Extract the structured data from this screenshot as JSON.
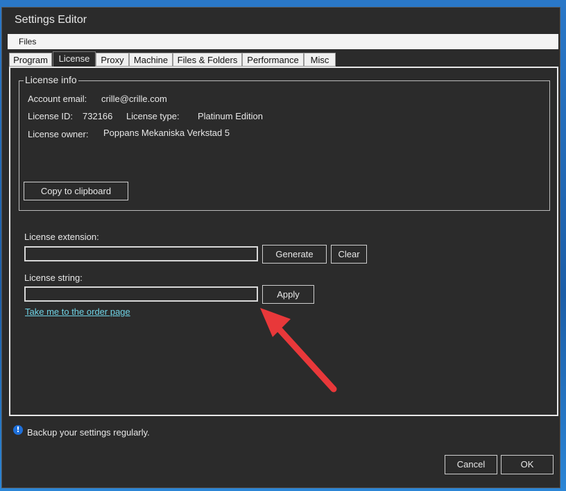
{
  "window": {
    "title": "Settings Editor"
  },
  "menu": {
    "files": "Files"
  },
  "tabs": [
    {
      "label": "Program"
    },
    {
      "label": "License"
    },
    {
      "label": "Proxy"
    },
    {
      "label": "Machine"
    },
    {
      "label": "Files & Folders"
    },
    {
      "label": "Performance"
    },
    {
      "label": "Misc"
    }
  ],
  "active_tab": "License",
  "license_info": {
    "group_title": "License info",
    "account_email_label": "Account email:",
    "account_email_value": "crille@crille.com",
    "license_id_label": "License ID:",
    "license_id_value": "732166",
    "license_type_label": "License type:",
    "license_type_value": "Platinum Edition",
    "license_owner_label": "License owner:",
    "license_owner_value": "Poppans Mekaniska Verkstad 5",
    "copy_button": "Copy to clipboard"
  },
  "license_extension": {
    "label": "License extension:",
    "value": "",
    "generate_button": "Generate",
    "clear_button": "Clear"
  },
  "license_string": {
    "label": "License string:",
    "value": "",
    "apply_button": "Apply"
  },
  "order_link": "Take me to the order page",
  "status": {
    "text": "Backup your settings regularly."
  },
  "footer": {
    "cancel": "Cancel",
    "ok": "OK"
  },
  "colors": {
    "accent_link": "#6fd3e6",
    "annotation_arrow": "#e8383a",
    "info_icon": "#1e6fd9"
  },
  "icons": {
    "info": "info-icon"
  }
}
